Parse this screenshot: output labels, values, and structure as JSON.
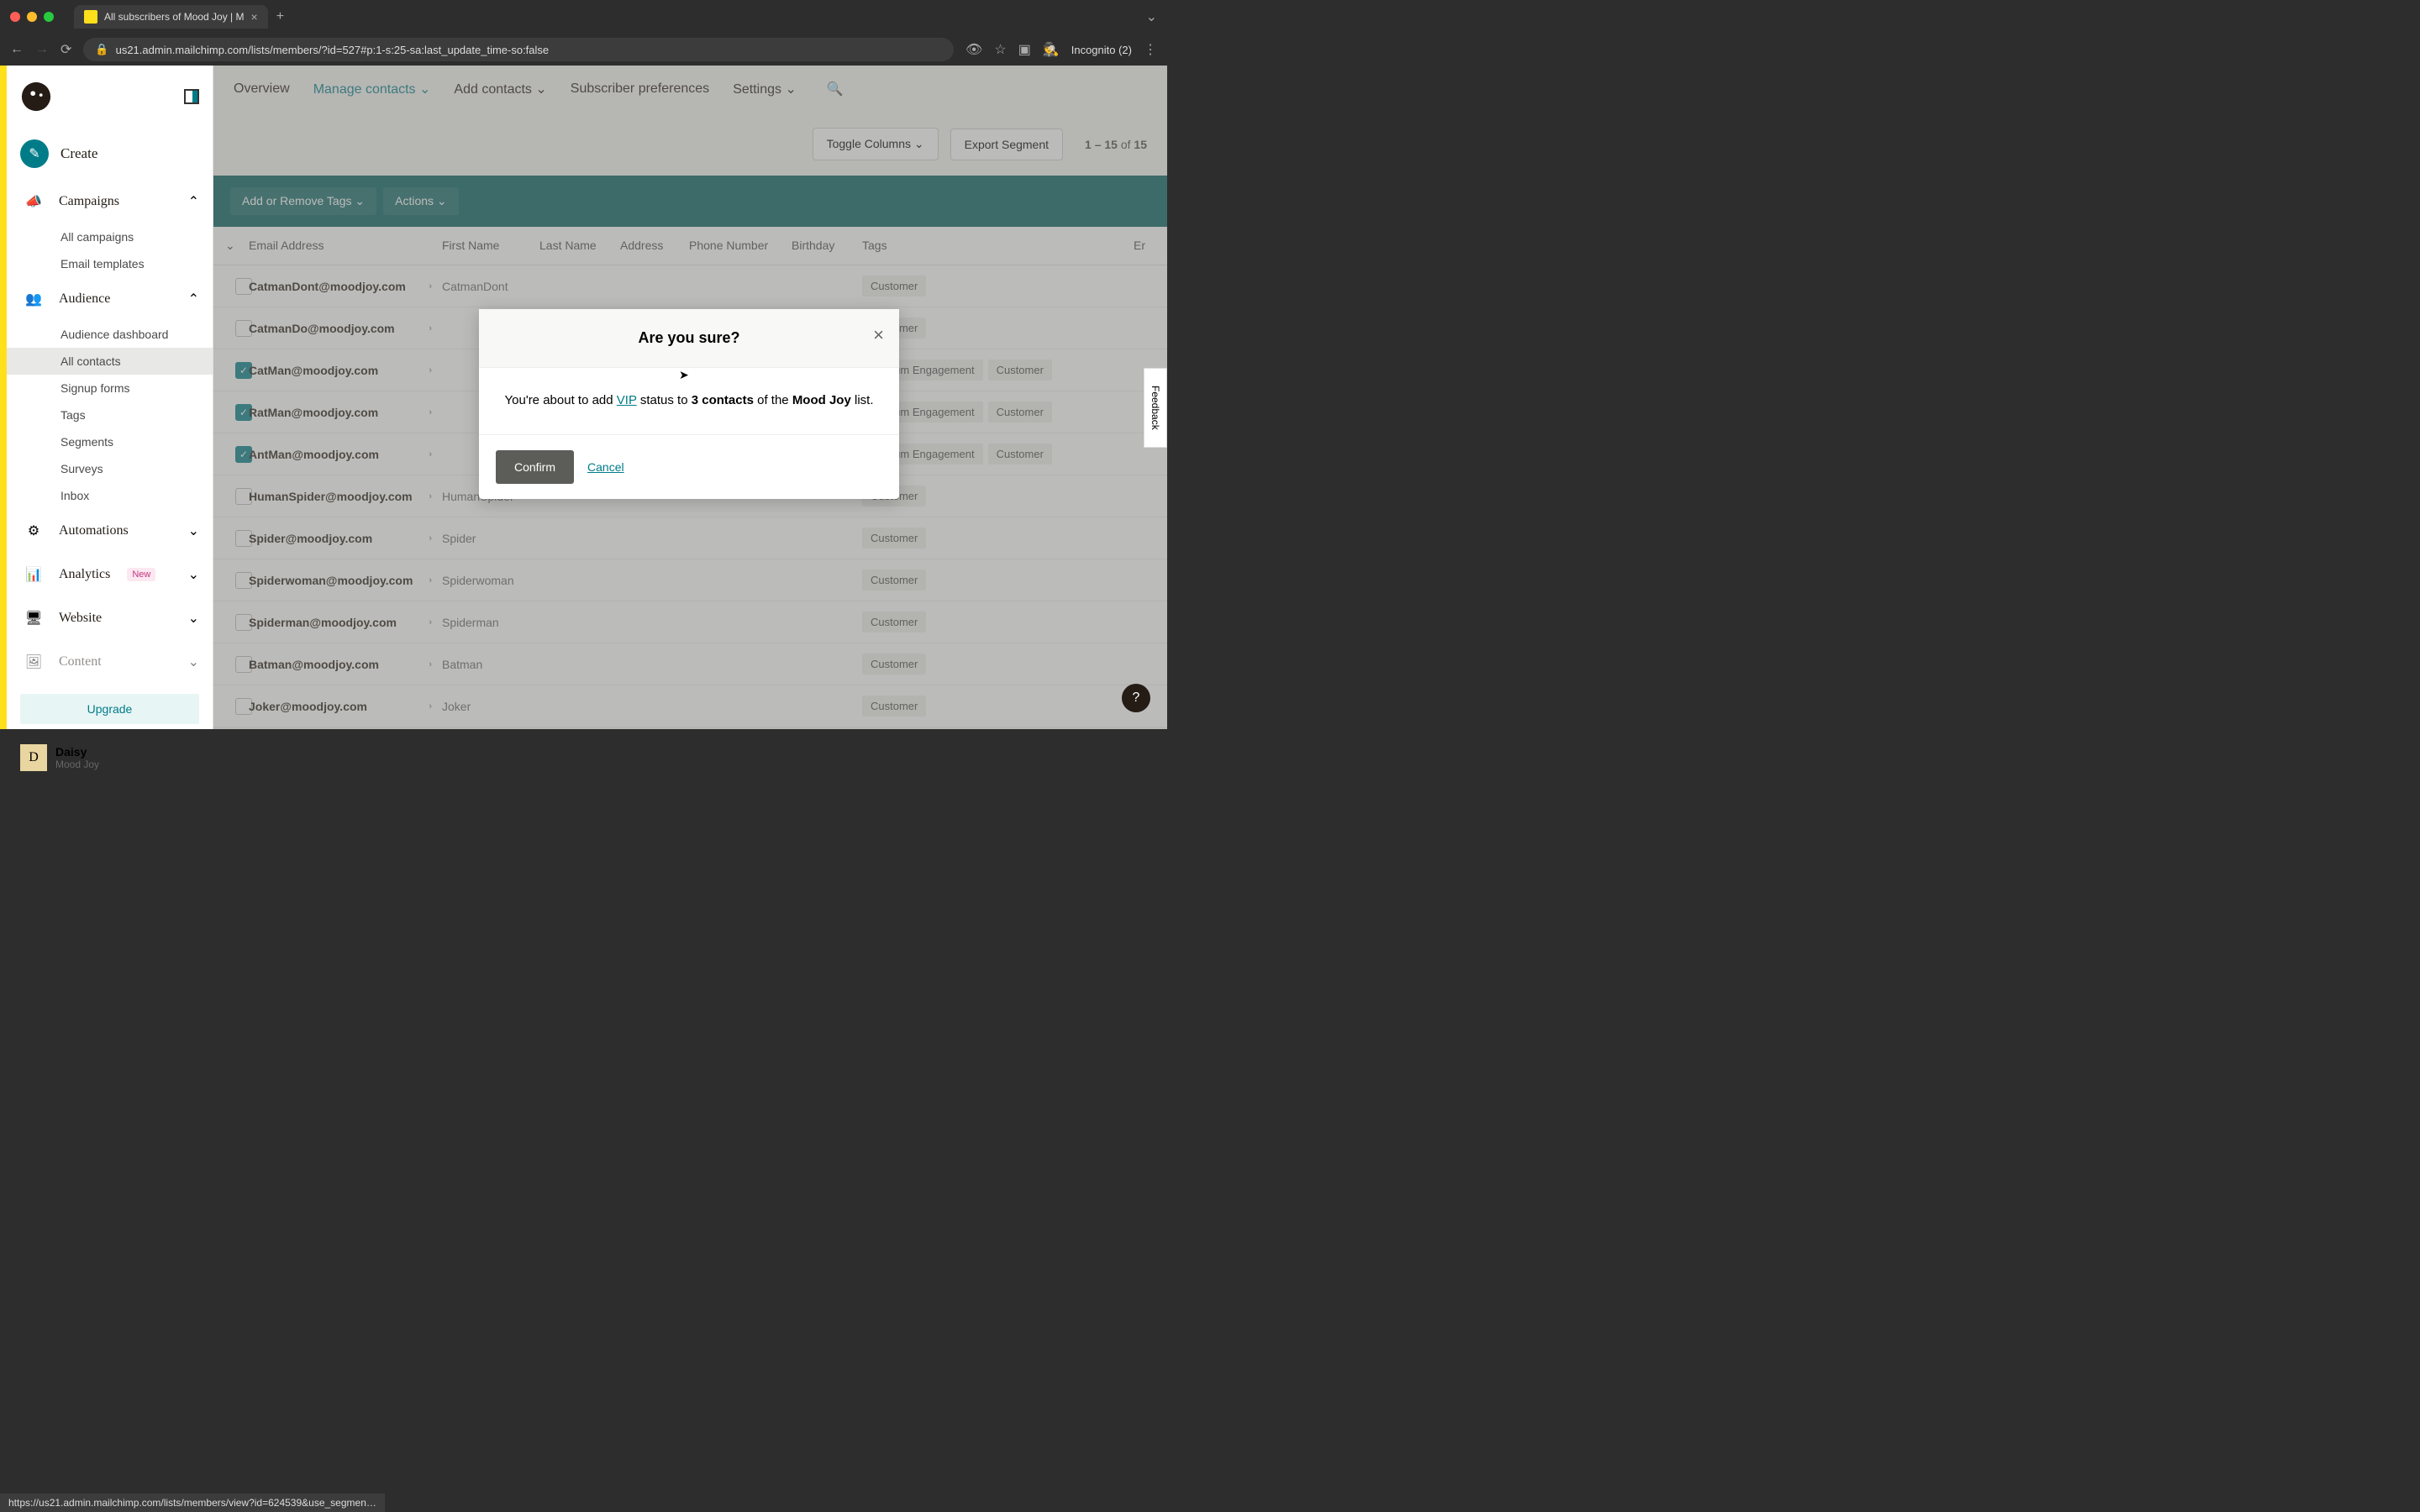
{
  "browser": {
    "tab_title": "All subscribers of Mood Joy | M",
    "url": "us21.admin.mailchimp.com/lists/members/?id=527#p:1-s:25-sa:last_update_time-so:false",
    "incognito": "Incognito (2)",
    "status_bar": "https://us21.admin.mailchimp.com/lists/members/view?id=624539&use_segmen…"
  },
  "sidebar": {
    "create": "Create",
    "campaigns": {
      "label": "Campaigns",
      "items": [
        "All campaigns",
        "Email templates"
      ]
    },
    "audience": {
      "label": "Audience",
      "items": [
        "Audience dashboard",
        "All contacts",
        "Signup forms",
        "Tags",
        "Segments",
        "Surveys",
        "Inbox"
      ]
    },
    "automations": "Automations",
    "analytics": "Analytics",
    "analytics_badge": "New",
    "website": "Website",
    "content": "Content",
    "upgrade": "Upgrade",
    "user": {
      "initial": "D",
      "name": "Daisy",
      "org": "Mood Joy"
    }
  },
  "topnav": {
    "items": [
      "Overview",
      "Manage contacts",
      "Add contacts",
      "Subscriber preferences",
      "Settings"
    ]
  },
  "toolbar": {
    "toggle_columns": "Toggle Columns",
    "export_segment": "Export Segment",
    "page_info_a": "1 – 15",
    "page_info_b": "of",
    "page_info_c": "15"
  },
  "action_bar": {
    "tags": "Add or Remove Tags",
    "actions": "Actions"
  },
  "table": {
    "headers": [
      "Email Address",
      "First Name",
      "Last Name",
      "Address",
      "Phone Number",
      "Birthday",
      "Tags"
    ],
    "last_header": "Er",
    "rows": [
      {
        "checked": false,
        "email": "CatmanDont@moodjoy.com",
        "first": "CatmanDont",
        "tags": [
          "Customer"
        ]
      },
      {
        "checked": false,
        "email": "CatmanDo@moodjoy.com",
        "first": "",
        "tags": [
          "Customer"
        ]
      },
      {
        "checked": true,
        "email": "CatMan@moodjoy.com",
        "first": "",
        "tags": [
          "Medium Engagement",
          "Customer"
        ]
      },
      {
        "checked": true,
        "email": "RatMan@moodjoy.com",
        "first": "",
        "tags": [
          "Medium Engagement",
          "Customer"
        ]
      },
      {
        "checked": true,
        "email": "AntMan@moodjoy.com",
        "first": "",
        "tags": [
          "Medium Engagement",
          "Customer"
        ]
      },
      {
        "checked": false,
        "email": "HumanSpider@moodjoy.com",
        "first": "HumanSpider",
        "tags": [
          "Customer"
        ]
      },
      {
        "checked": false,
        "email": "Spider@moodjoy.com",
        "first": "Spider",
        "tags": [
          "Customer"
        ]
      },
      {
        "checked": false,
        "email": "Spiderwoman@moodjoy.com",
        "first": "Spiderwoman",
        "tags": [
          "Customer"
        ]
      },
      {
        "checked": false,
        "email": "Spiderman@moodjoy.com",
        "first": "Spiderman",
        "tags": [
          "Customer"
        ]
      },
      {
        "checked": false,
        "email": "Batman@moodjoy.com",
        "first": "Batman",
        "tags": [
          "Customer"
        ]
      },
      {
        "checked": false,
        "email": "Joker@moodjoy.com",
        "first": "Joker",
        "tags": [
          "Customer"
        ]
      }
    ]
  },
  "modal": {
    "title": "Are you sure?",
    "body_pre": "You're about to add ",
    "vip": "VIP",
    "body_mid": " status to ",
    "count": "3 contacts",
    "body_post": " of the ",
    "list": "Mood Joy",
    "body_end": " list.",
    "confirm": "Confirm",
    "cancel": "Cancel"
  },
  "feedback": "Feedback"
}
